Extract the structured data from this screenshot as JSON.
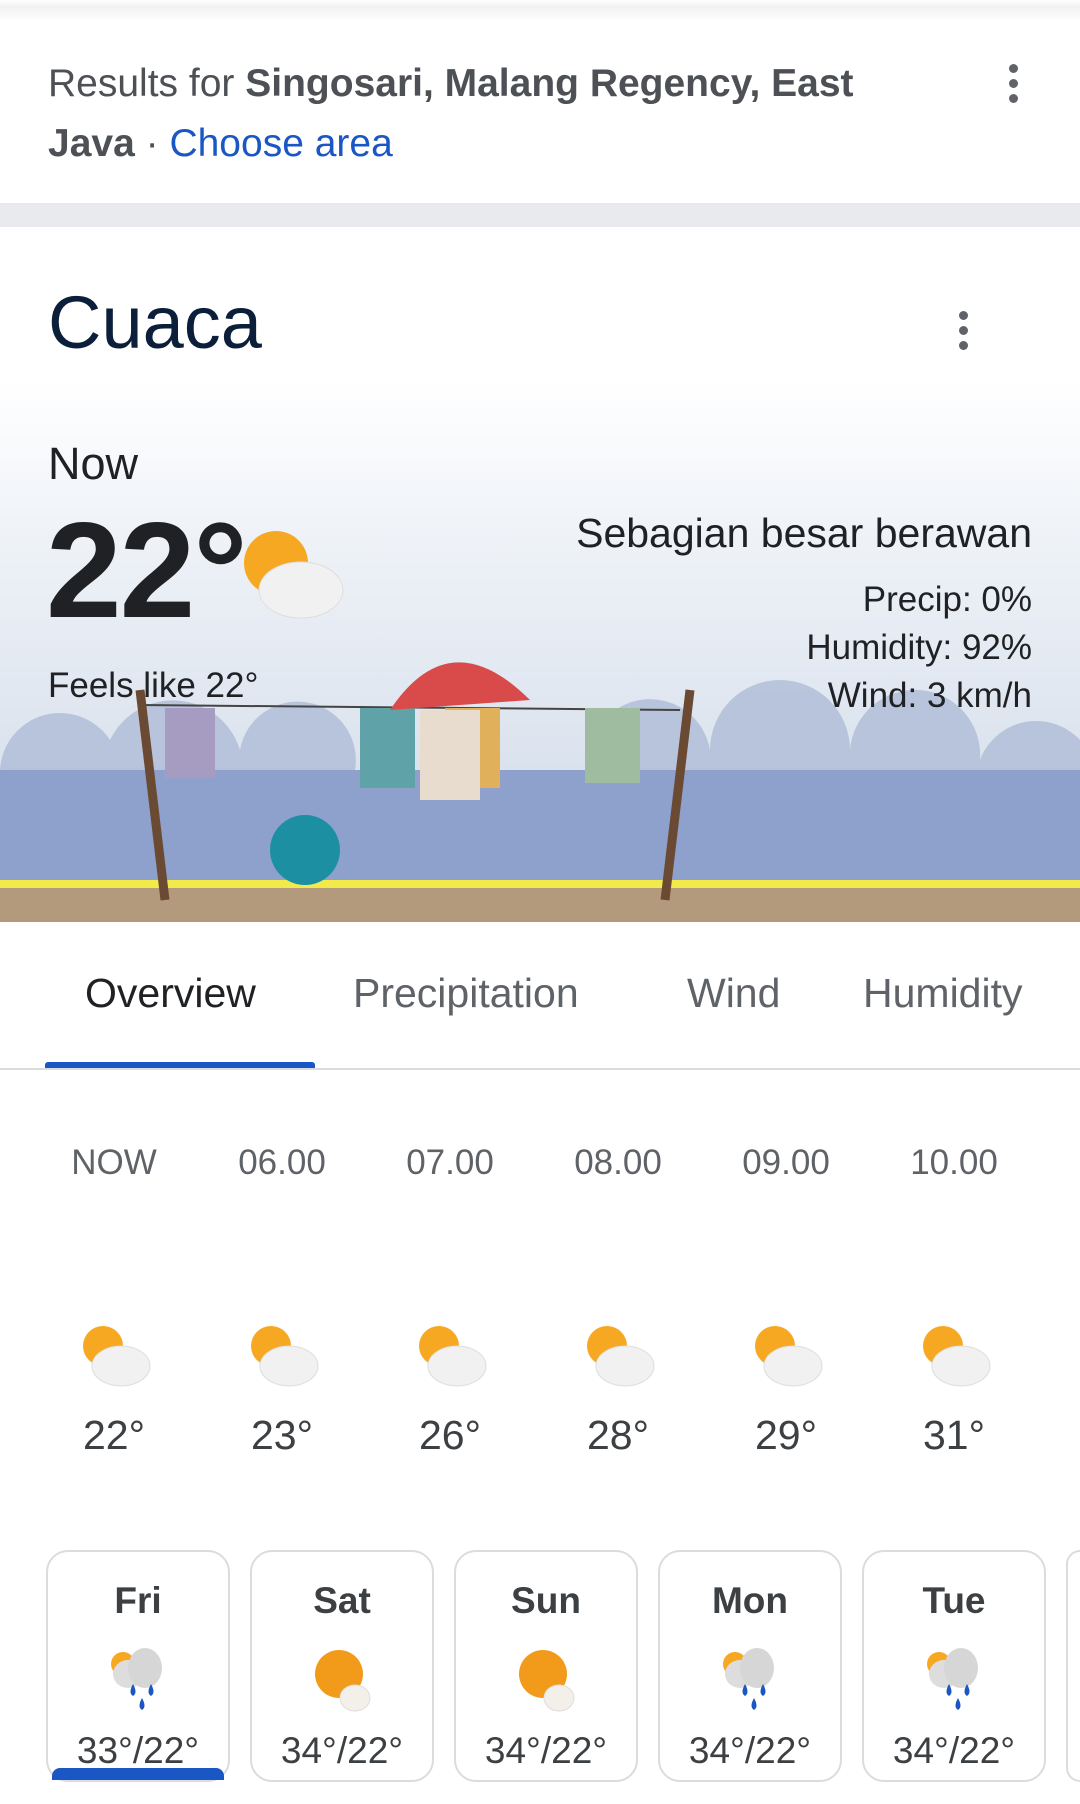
{
  "location": {
    "prefix": "Results for",
    "place": "Singosari, Malang Regency, East Java",
    "separator": "·",
    "choose_area": "Choose area"
  },
  "weather": {
    "title": "Cuaca",
    "now_label": "Now",
    "temperature": "22°",
    "feels_like": "Feels like 22°",
    "condition": "Sebagian besar berawan",
    "precip": "Precip: 0%",
    "humidity": "Humidity: 92%",
    "wind": "Wind: 3 km/h",
    "icon": "partly-cloudy-icon"
  },
  "tabs": [
    {
      "label": "Overview",
      "active": true
    },
    {
      "label": "Precipitation"
    },
    {
      "label": "Wind"
    },
    {
      "label": "Humidity"
    }
  ],
  "hourly": [
    {
      "time": "NOW",
      "temp": "22°",
      "icon": "partly-cloudy"
    },
    {
      "time": "06.00",
      "temp": "23°",
      "icon": "partly-cloudy"
    },
    {
      "time": "07.00",
      "temp": "26°",
      "icon": "partly-cloudy"
    },
    {
      "time": "08.00",
      "temp": "28°",
      "icon": "partly-cloudy"
    },
    {
      "time": "09.00",
      "temp": "29°",
      "icon": "partly-cloudy"
    },
    {
      "time": "10.00",
      "temp": "31°",
      "icon": "partly-cloudy"
    }
  ],
  "daily": [
    {
      "day": "Fri",
      "temps": "33°/22°",
      "icon": "rain-showers",
      "selected": true
    },
    {
      "day": "Sat",
      "temps": "34°/22°",
      "icon": "mostly-sunny"
    },
    {
      "day": "Sun",
      "temps": "34°/22°",
      "icon": "mostly-sunny"
    },
    {
      "day": "Mon",
      "temps": "34°/22°",
      "icon": "rain-showers"
    },
    {
      "day": "Tue",
      "temps": "34°/22°",
      "icon": "rain-showers"
    }
  ],
  "colors": {
    "accent": "#1a57c4",
    "sun": "#f7a823",
    "cloud": "#e8e8e8",
    "rain": "#1a57c4"
  }
}
